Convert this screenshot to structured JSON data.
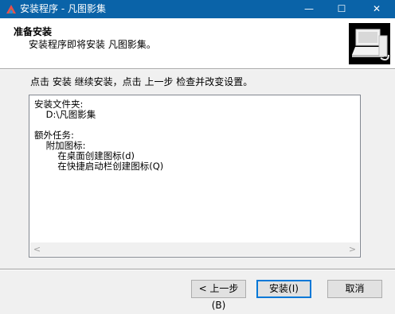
{
  "window": {
    "title": "安装程序 - 凡图影集",
    "minimize_glyph": "—",
    "maximize_glyph": "☐",
    "close_glyph": "✕",
    "app_icon": "app-logo-icon"
  },
  "header": {
    "title": "准备安装",
    "subtitle": "安装程序即将安装 凡图影集。",
    "logo_icon": "installer-computer-icon"
  },
  "main": {
    "instruction": "点击 安装 继续安装，点击 上一步 检查并改变设置。",
    "details": [
      "安装文件夹:",
      "    D:\\凡图影集",
      "",
      "额外任务:",
      "    附加图标:",
      "        在桌面创建图标(d)",
      "        在快捷启动栏创建图标(Q)"
    ],
    "scroll_left_glyph": "<",
    "scroll_right_glyph": ">"
  },
  "buttons": {
    "back": "< 上一步(B)",
    "install": "安装(I)",
    "cancel": "取消"
  },
  "colors": {
    "titlebar": "#0a63a8",
    "accent_border": "#0078d7"
  }
}
